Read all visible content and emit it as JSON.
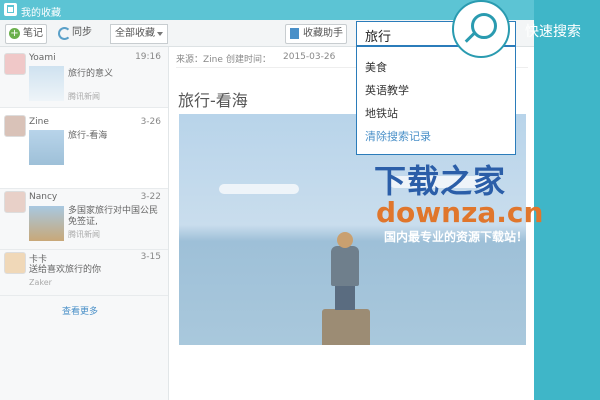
{
  "window": {
    "title": "我的收藏"
  },
  "toolbar": {
    "note_label": "笔记",
    "sync_label": "同步",
    "filter_value": "全部收藏",
    "helper_label": "收藏助手"
  },
  "list": {
    "items": [
      {
        "name": "Yoami",
        "date": "19:16",
        "summary": "旅行的意义",
        "source": "腾讯新闻"
      },
      {
        "name": "Zine",
        "date": "3-26",
        "summary": "旅行-看海",
        "source": ""
      },
      {
        "name": "Nancy",
        "date": "3-22",
        "summary": "多国家旅行对中国公民免签证,",
        "source": "腾讯新闻"
      },
      {
        "name": "卡卡",
        "date": "3-15",
        "summary": "送给喜欢旅行的你",
        "source": "Zaker"
      }
    ],
    "more_label": "查看更多"
  },
  "detail": {
    "source": "来源：Zine",
    "created_label": "创建时间：",
    "created_value": "2015-03-26",
    "title": "旅行-看海"
  },
  "search": {
    "value": "旅行",
    "suggestions": [
      "美食",
      "英语教学",
      "地铁站"
    ],
    "clear_label": "清除搜索记录",
    "quick_label": "快速搜索"
  },
  "watermark": {
    "line1": "下载之家",
    "line2": "downza.cn",
    "line3": "国内最专业的资源下载站！"
  },
  "colors": {
    "accent": "#2b7cba",
    "titlebar": "#5cc4d4",
    "background": "#3fb6c8"
  }
}
